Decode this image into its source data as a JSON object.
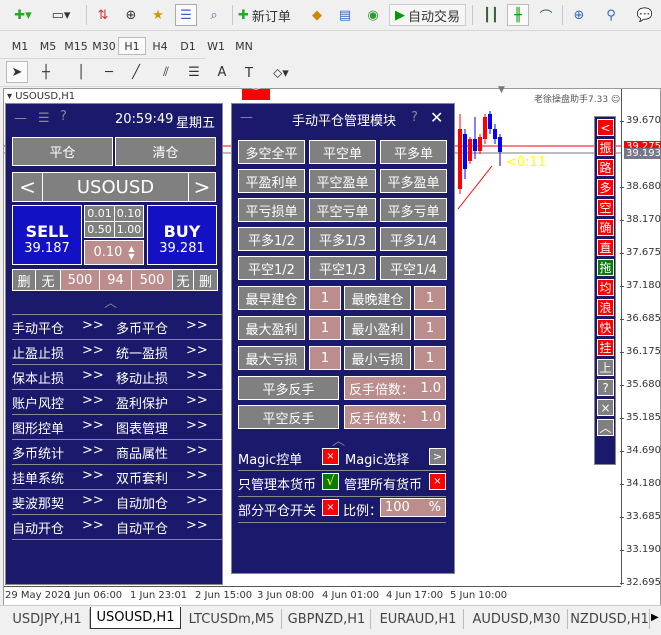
{
  "toolbar": {
    "new_order": "新订单",
    "auto_trade": "自动交易"
  },
  "timeframes": [
    "M1",
    "M5",
    "M15",
    "M30",
    "H1",
    "H4",
    "D1",
    "W1",
    "MN"
  ],
  "active_timeframe": "H1",
  "chart": {
    "title": "USOUSD,H1",
    "ea_label": "老徐操盘助手7.33",
    "countdown": "<0:11",
    "prices": [
      "39.670",
      "38.680",
      "38.170",
      "37.675",
      "37.180",
      "36.685",
      "36.175",
      "35.680",
      "35.185",
      "34.690",
      "34.180",
      "33.685",
      "33.190",
      "32.695"
    ],
    "ask_price": "39.275",
    "bid_price": "39.193",
    "times": [
      "29 May 2020",
      "1 Jun 06:00",
      "1 Jun 23:01",
      "2 Jun 15:00",
      "3 Jun 08:00",
      "4 Jun 01:00",
      "4 Jun 17:00",
      "5 Jun 10:00"
    ]
  },
  "left": {
    "min": "—",
    "menu": "☰",
    "help": "?",
    "time": "20:59:49",
    "weekday": "星期五",
    "close_btn": "平仓",
    "clear_btn": "清仓",
    "prev": "<",
    "symbol": "USOUSD",
    "next": ">",
    "sell": "SELL",
    "sell_price": "39.187",
    "buy": "BUY",
    "buy_price": "39.281",
    "lots": [
      "0.01",
      "0.10",
      "0.50",
      "1.00"
    ],
    "lot_value": "0.10",
    "sltp": [
      "删",
      "无",
      "500",
      "94",
      "500",
      "无",
      "删"
    ],
    "collapse": "︿",
    "menu_items": [
      [
        "手动平仓",
        "多币平仓"
      ],
      [
        "止盈止损",
        "统一盈损"
      ],
      [
        "保本止损",
        "移动止损"
      ],
      [
        "账户风控",
        "盈利保护"
      ],
      [
        "图形控单",
        "图表管理"
      ],
      [
        "多币统计",
        "商品属性"
      ],
      [
        "挂单系统",
        "双币套利"
      ],
      [
        "斐波那契",
        "自动加仓"
      ],
      [
        "自动开仓",
        "自动平仓"
      ]
    ],
    "arrow": ">>"
  },
  "mid": {
    "min": "—",
    "title": "手动平仓管理模块",
    "help": "?",
    "close": "✕",
    "grid": [
      [
        "多空全平",
        "平空单",
        "平多单"
      ],
      [
        "平盈利单",
        "平空盈单",
        "平多盈单"
      ],
      [
        "平亏损单",
        "平空亏单",
        "平多亏单"
      ],
      [
        "平多1/2",
        "平多1/3",
        "平多1/4"
      ],
      [
        "平空1/2",
        "平空1/3",
        "平空1/4"
      ]
    ],
    "pairs": [
      [
        "最早建仓",
        "1",
        "最晚建仓",
        "1"
      ],
      [
        "最大盈利",
        "1",
        "最小盈利",
        "1"
      ],
      [
        "最大亏损",
        "1",
        "最小亏损",
        "1"
      ]
    ],
    "rev_long": "平多反手",
    "rev_short": "平空反手",
    "mult_label": "反手倍数：",
    "mult1": "1.0",
    "mult2": "1.0",
    "collapse": "︿",
    "magic_ctrl": "Magic控单",
    "magic_sel": "Magic选择",
    "sel_arrow": ">",
    "only_cur": "只管理本货币",
    "all_cur": "管理所有货币",
    "partial": "部分平仓开关",
    "ratio": "比例：",
    "ratio_val": "100",
    "pct": "%",
    "x": "×",
    "check": "√"
  },
  "side": [
    {
      "t": "<",
      "c": "red"
    },
    {
      "t": "振",
      "c": "red"
    },
    {
      "t": "路",
      "c": "red"
    },
    {
      "t": "多",
      "c": "red"
    },
    {
      "t": "空",
      "c": "red"
    },
    {
      "t": "确",
      "c": "red"
    },
    {
      "t": "直",
      "c": "red"
    },
    {
      "t": "拖",
      "c": "grn"
    },
    {
      "t": "均",
      "c": "red"
    },
    {
      "t": "浪",
      "c": "red"
    },
    {
      "t": "快",
      "c": "red"
    },
    {
      "t": "挂",
      "c": "red"
    },
    {
      "t": "上",
      "c": "gray"
    },
    {
      "t": "?",
      "c": "gray"
    },
    {
      "t": "×",
      "c": "gray"
    },
    {
      "t": "︿",
      "c": "gray"
    }
  ],
  "tabs": [
    "USDJPY,H1",
    "USOUSD,H1",
    "LTCUSDm,M5",
    "GBPNZD,H1",
    "EURAUD,H1",
    "AUDUSD,M30",
    "NZDUSD,H1"
  ],
  "active_tab": "USOUSD,H1"
}
